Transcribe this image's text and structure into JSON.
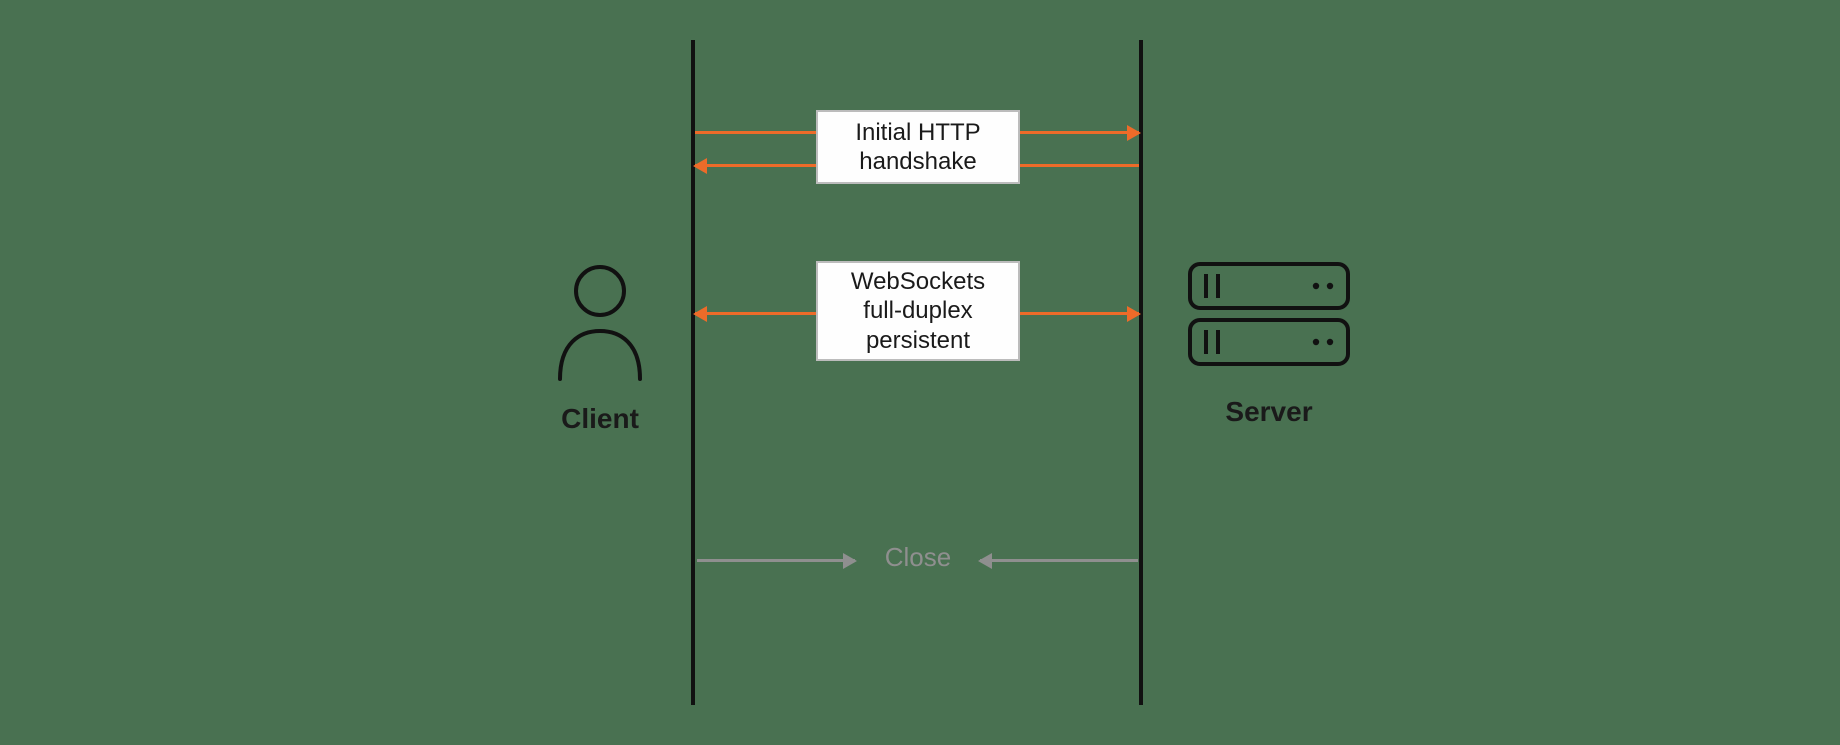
{
  "diagram": {
    "client_label": "Client",
    "server_label": "Server",
    "messages": {
      "handshake": "Initial HTTP\nhandshake",
      "websocket": "WebSockets\nfull-duplex\npersistent",
      "close": "Close"
    },
    "colors": {
      "background": "#497151",
      "arrow_primary": "#ed6b29",
      "arrow_muted": "#8f8f8f",
      "lifeline": "#111111",
      "box_bg": "#fefefe",
      "box_border": "#bcbcbc"
    },
    "arrows": [
      {
        "name": "handshake-request",
        "dir": "client-to-server",
        "color": "orange"
      },
      {
        "name": "handshake-response",
        "dir": "server-to-client",
        "color": "orange"
      },
      {
        "name": "websocket-duplex",
        "dir": "bidirectional",
        "color": "orange"
      },
      {
        "name": "close-from-client",
        "dir": "client-to-center",
        "color": "grey"
      },
      {
        "name": "close-from-server",
        "dir": "server-to-center",
        "color": "grey"
      }
    ]
  }
}
